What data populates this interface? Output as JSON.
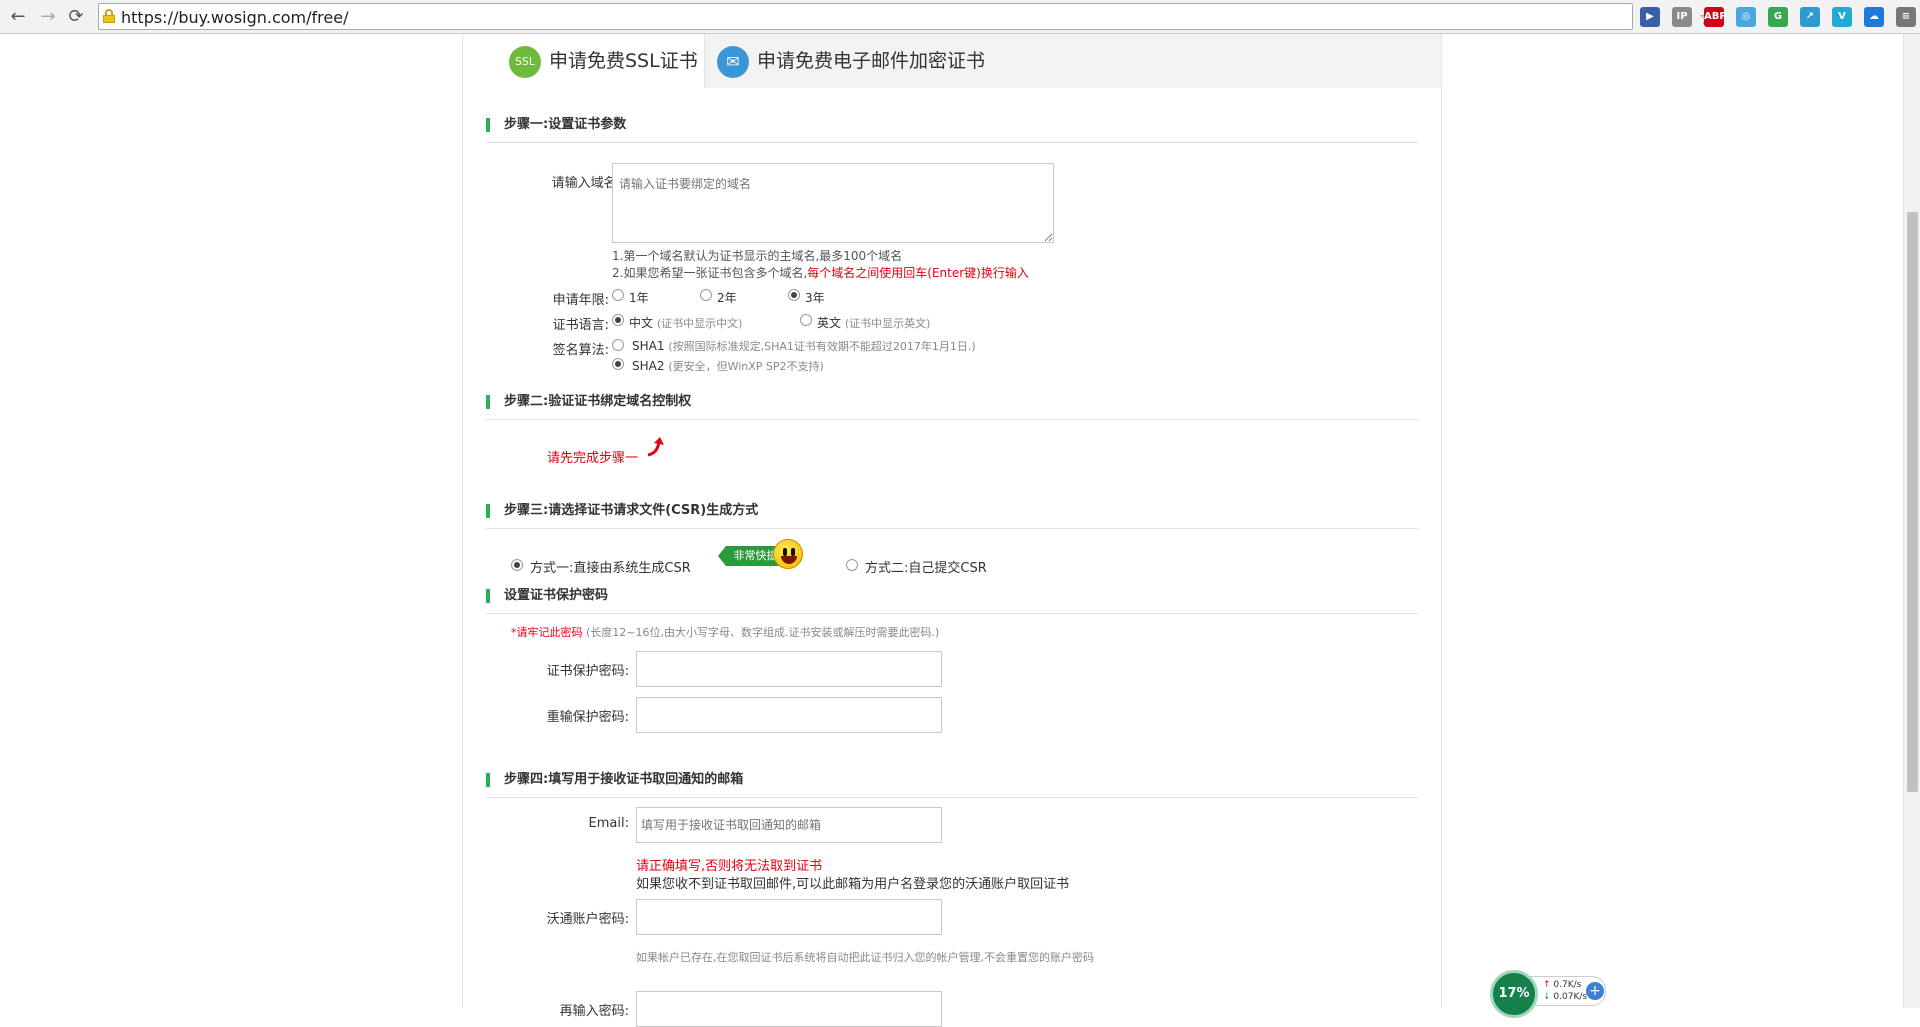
{
  "browser": {
    "url": "https://buy.wosign.com/free/",
    "back": "←",
    "forward": "→",
    "reload": "⟳",
    "star": "☆",
    "extensions": [
      {
        "name": "ext-pin",
        "label": "▶",
        "color": "#3a5ea8"
      },
      {
        "name": "ext-ip",
        "label": "IP",
        "color": "#8a8a8a"
      },
      {
        "name": "ext-abp",
        "label": "ABP",
        "color": "#d0021b"
      },
      {
        "name": "ext-sync",
        "label": "◎",
        "color": "#49a8e0"
      },
      {
        "name": "ext-translate",
        "label": "G",
        "color": "#36a852"
      },
      {
        "name": "ext-share",
        "label": "↗",
        "color": "#2e9ad0"
      },
      {
        "name": "ext-vimium",
        "label": "V",
        "color": "#23aad4"
      },
      {
        "name": "ext-cloud",
        "label": "☁",
        "color": "#1c7ad8"
      },
      {
        "name": "ext-menu",
        "label": "≡",
        "color": "#777777"
      }
    ]
  },
  "tabs": [
    {
      "label": "申请免费SSL证书",
      "icon": "SSL",
      "icon_color": "#6cbb3c"
    },
    {
      "label": "申请免费电子邮件加密证书",
      "icon": "✉",
      "icon_color": "#3a96d6"
    }
  ],
  "step1": {
    "title": "步骤一:设置证书参数",
    "domain_label": "请输入域名:",
    "domain_placeholder": "请输入证书要绑定的域名",
    "hint1": "1.第一个域名默认为证书显示的主域名,最多100个域名",
    "hint2_prefix": "2.如果您希望一张证书包含多个域名,",
    "hint2_red": "每个域名之间使用回车(Enter键)换行输入",
    "years_label": "申请年限:",
    "years": [
      "1年",
      "2年",
      "3年"
    ],
    "lang_label": "证书语言:",
    "lang_cn": "中文",
    "lang_cn_note": "(证书中显示中文)",
    "lang_en": "英文",
    "lang_en_note": "(证书中显示英文)",
    "algo_label": "签名算法:",
    "sha1": "SHA1",
    "sha1_note": "(按照国际标准规定,SHA1证书有效期不能超过2017年1月1日.)",
    "sha2": "SHA2",
    "sha2_note": "(更安全，但WinXP SP2不支持)"
  },
  "step2": {
    "title": "步骤二:验证证书绑定域名控制权",
    "notice": "请先完成步骤一"
  },
  "step3": {
    "title": "步骤三:请选择证书请求文件(CSR)生成方式",
    "option1": "方式一:直接由系统生成CSR",
    "badge": "非常快捷",
    "option2": "方式二:自己提交CSR"
  },
  "password": {
    "title": "设置证书保护密码",
    "remember": "*请牢记此密码",
    "remember_note": "(长度12~16位,由大小写字母、数字组成.证书安装或解压时需要此密码.)",
    "pwd_label": "证书保护密码:",
    "pwd2_label": "重输保护密码:"
  },
  "step4": {
    "title": "步骤四:填写用于接收证书取回通知的邮箱",
    "email_label": "Email:",
    "email_placeholder": "填写用于接收证书取回通知的邮箱",
    "email_warning": "请正确填写,否则将无法取到证书",
    "email_note": "如果您收不到证书取回邮件,可以此邮箱为用户名登录您的沃通账户取回证书",
    "account_label": "沃通账户密码:",
    "account_note": "如果帐户已存在,在您取回证书后系统将自动把此证书归入您的帐户管理,不会重置您的账户密码",
    "reenter_label": "再输入密码:"
  },
  "net_widget": {
    "percent": "17%",
    "up": "0.7K/s",
    "down": "0.07K/s"
  }
}
